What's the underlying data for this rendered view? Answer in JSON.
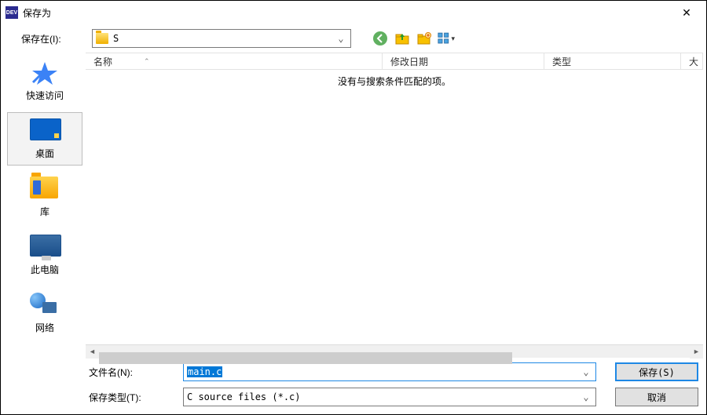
{
  "window": {
    "title": "保存为"
  },
  "toprow": {
    "label": "保存在(I):",
    "location": "S"
  },
  "nav_icons": {
    "back": "back-icon",
    "up": "up-one-level-icon",
    "new_folder": "new-folder-icon",
    "views": "views-icon"
  },
  "places": [
    {
      "id": "quick",
      "label": "快速访问",
      "selected": false
    },
    {
      "id": "desktop",
      "label": "桌面",
      "selected": true
    },
    {
      "id": "library",
      "label": "库",
      "selected": false
    },
    {
      "id": "thispc",
      "label": "此电脑",
      "selected": false
    },
    {
      "id": "network",
      "label": "网络",
      "selected": false
    }
  ],
  "columns": {
    "name": "名称",
    "date": "修改日期",
    "type": "类型",
    "size": "大"
  },
  "list": {
    "empty_message": "没有与搜索条件匹配的项。"
  },
  "form": {
    "filename_label": "文件名(N):",
    "filename_value": "main.c",
    "filetype_label": "保存类型(T):",
    "filetype_value": "C source files (*.c)"
  },
  "buttons": {
    "save": "保存(S)",
    "cancel": "取消"
  }
}
